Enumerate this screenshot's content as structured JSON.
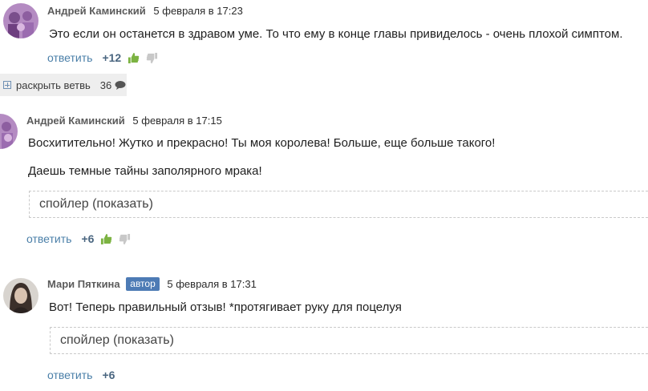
{
  "thread": {
    "comments": [
      {
        "author": "Андрей Каминский",
        "date": "5 февраля в 17:23",
        "text": "Это если он останется в здравом уме. То что ему в конце главы привиделось - очень  плохой симптом.",
        "reply_label": "ответить",
        "score": "+12"
      },
      {
        "author": "Андрей Каминский",
        "date": "5 февраля в 17:15",
        "paragraph1": "Восхитительно! Жутко и прекрасно! Ты моя королева! Больше, еще больше такого!",
        "paragraph2": "Даешь темные тайны заполярного мрака!",
        "spoiler_label": "спойлер (показать)",
        "reply_label": "ответить",
        "score": "+6"
      },
      {
        "author": "Мари Пяткина",
        "badge": "автор",
        "date": "5 февраля в 17:31",
        "text": "Вот! Теперь правильный отзыв! *протягивает руку для поцелуя",
        "spoiler_label": "спойлер (показать)",
        "reply_label": "ответить",
        "score": "+6"
      }
    ],
    "expand_branch": {
      "label": "раскрыть ветвь",
      "count": "36"
    }
  },
  "colors": {
    "reply_link": "#4a7fa8",
    "like_green": "#7cb342",
    "dislike_gray": "#c8c8c8",
    "badge_blue": "#4d7bb5"
  }
}
